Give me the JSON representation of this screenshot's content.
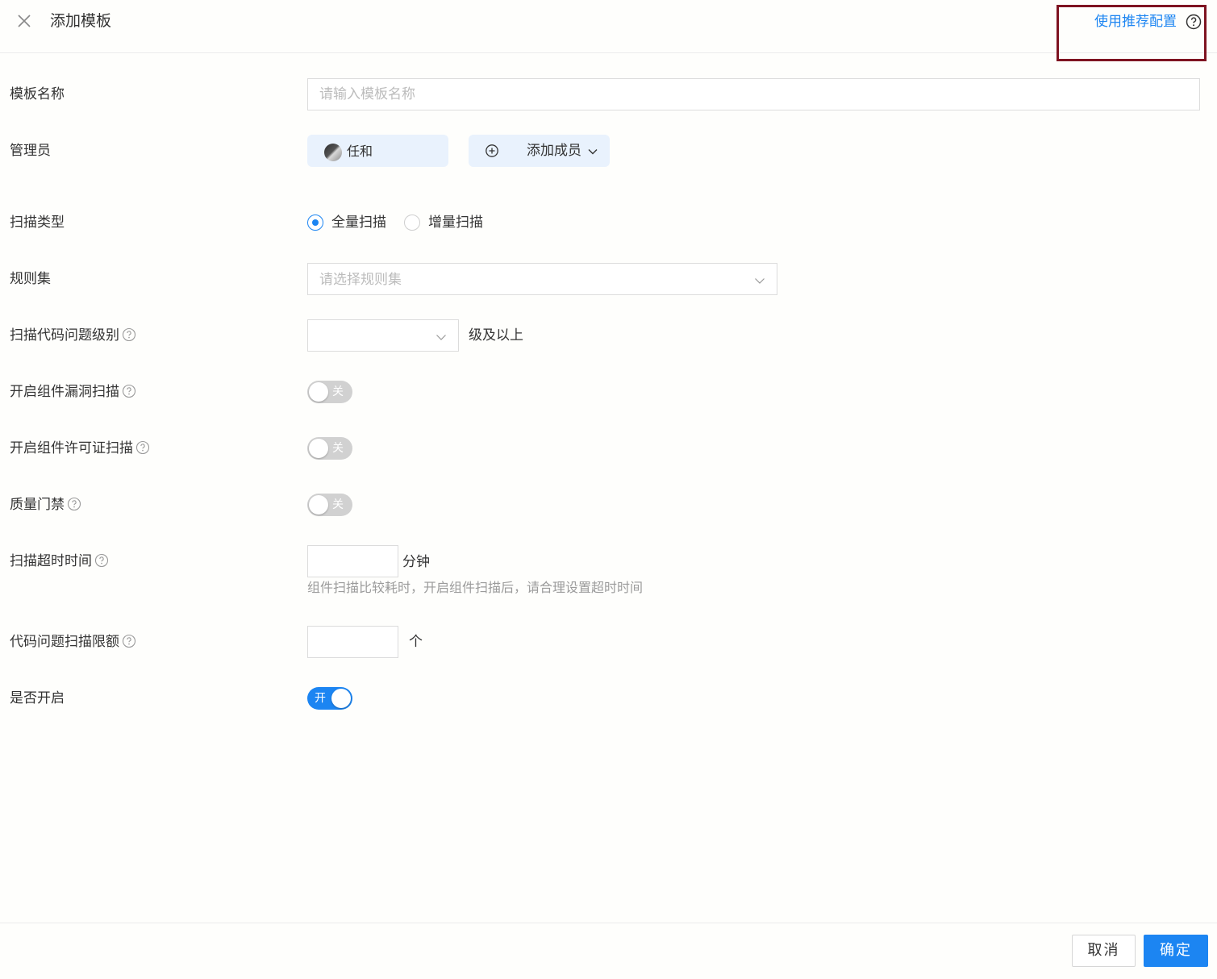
{
  "header": {
    "title": "添加模板",
    "recommend_link": "使用推荐配置"
  },
  "form": {
    "template_name": {
      "label": "模板名称",
      "placeholder": "请输入模板名称",
      "value": ""
    },
    "admin": {
      "label": "管理员",
      "member_name": "任和",
      "add_member_label": "添加成员"
    },
    "scan_type": {
      "label": "扫描类型",
      "options": [
        "全量扫描",
        "增量扫描"
      ],
      "selected": "全量扫描"
    },
    "rule_set": {
      "label": "规则集",
      "placeholder": "请选择规则集"
    },
    "issue_level": {
      "label": "扫描代码问题级别",
      "value": "",
      "suffix": "级及以上"
    },
    "component_vuln_scan": {
      "label": "开启组件漏洞扫描",
      "state": "关",
      "on": false
    },
    "component_license_scan": {
      "label": "开启组件许可证扫描",
      "state": "关",
      "on": false
    },
    "quality_gate": {
      "label": "质量门禁",
      "state": "关",
      "on": false
    },
    "scan_timeout": {
      "label": "扫描超时时间",
      "value": "",
      "unit": "分钟",
      "hint": "组件扫描比较耗时，开启组件扫描后，请合理设置超时时间"
    },
    "issue_limit": {
      "label": "代码问题扫描限额",
      "value": "",
      "unit": "个"
    },
    "enabled": {
      "label": "是否开启",
      "state": "开",
      "on": true
    }
  },
  "footer": {
    "cancel_label": "取消",
    "confirm_label": "确定"
  },
  "colors": {
    "accent": "#1c85f2",
    "highlight_border": "#7e1321",
    "toggle_off": "#d1d1d1",
    "chip_bg": "#e9f2fd"
  }
}
